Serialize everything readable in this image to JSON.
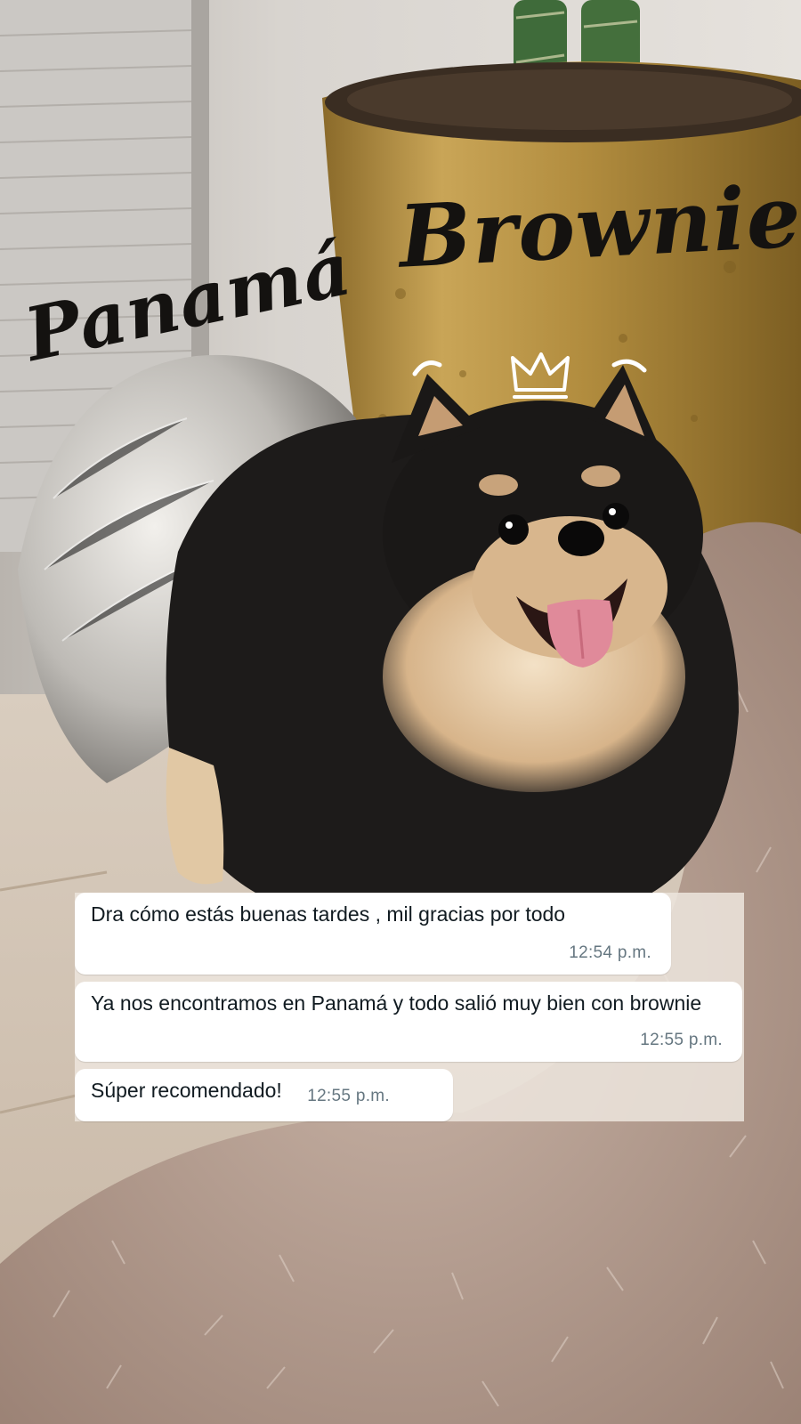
{
  "stickers": {
    "name_label": "Brownie",
    "location_label": "Panamá",
    "crown_icon": "crown-icon",
    "sticker_color": "#141210"
  },
  "chat": {
    "bubble_color": "#ffffff",
    "panel_color": "#ece5dd",
    "messages": [
      {
        "text": "Dra cómo estás buenas tardes , mil gracias por todo",
        "time": "12:54 p.m."
      },
      {
        "text": "Ya nos encontramos en Panamá y todo salió muy bien con brownie",
        "time": "12:55 p.m."
      },
      {
        "text": "Súper recomendado!",
        "time": "12:55 p.m."
      }
    ]
  }
}
